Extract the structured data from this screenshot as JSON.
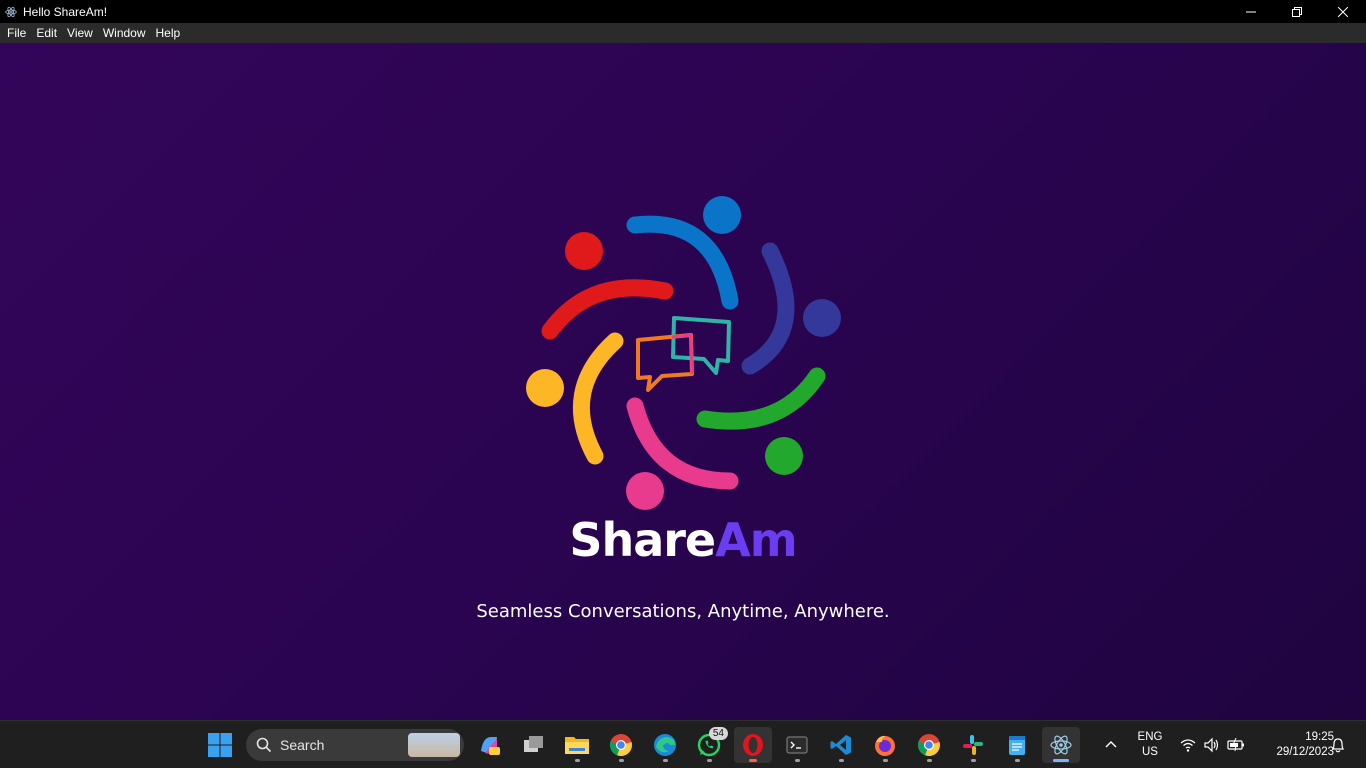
{
  "window": {
    "title": "Hello ShareAm!",
    "controls": {
      "minimize": "minimize",
      "maximize": "restore",
      "close": "close"
    }
  },
  "menu": [
    "File",
    "Edit",
    "View",
    "Window",
    "Help"
  ],
  "brand": {
    "name_part1": "Share",
    "name_part2": "Am",
    "tagline": "Seamless Conversations, Anytime, Anywhere.",
    "colors": {
      "background": "#2a0450",
      "accent": "#6a3df0",
      "red": "#e01a1a",
      "blue": "#0a74c8",
      "indigo": "#34389a",
      "green": "#22a82c",
      "pink": "#e83b8e",
      "yellow": "#fdb726",
      "orange": "#f07a22",
      "teal": "#2fb5a8"
    }
  },
  "taskbar": {
    "search_label": "Search",
    "apps": [
      "copilot",
      "task-view",
      "file-explorer",
      "chrome",
      "edge",
      "whatsapp",
      "opera",
      "terminal",
      "vscode",
      "firefox",
      "chrome-2",
      "slack",
      "notepad",
      "electron"
    ],
    "whatsapp_badge": "54",
    "language_line1": "ENG",
    "language_line2": "US",
    "time": "19:25",
    "date": "29/12/2023"
  }
}
